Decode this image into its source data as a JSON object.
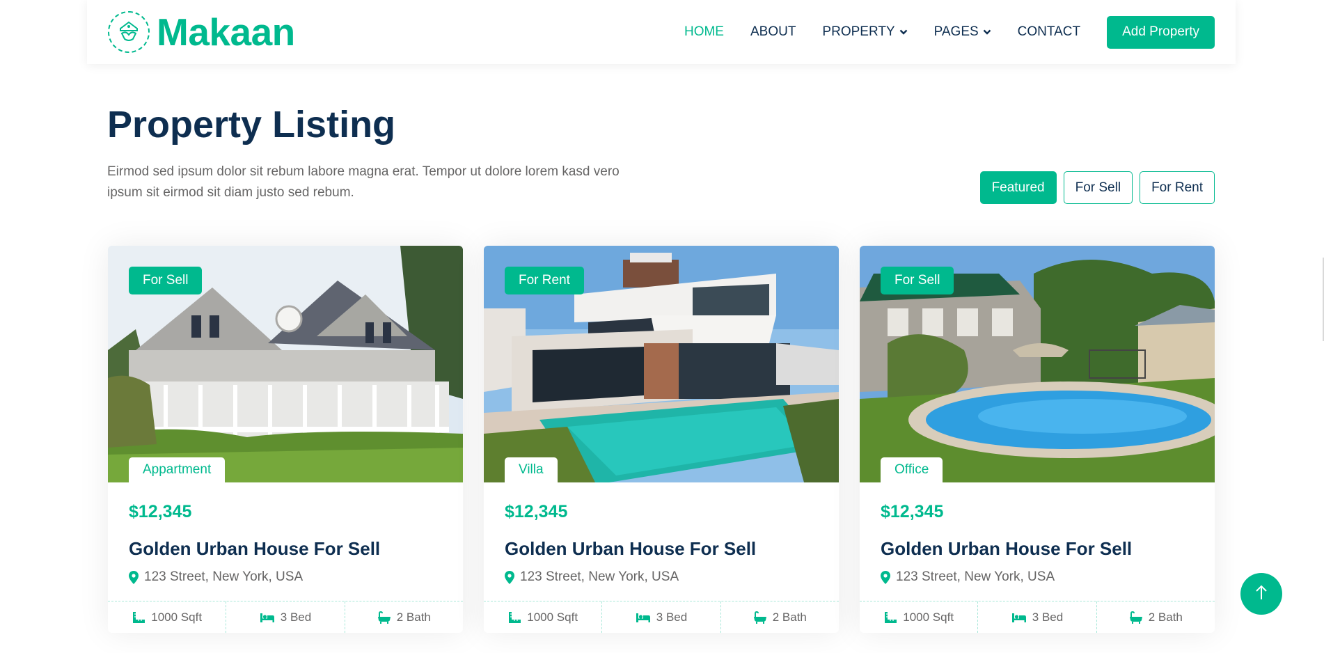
{
  "brand": {
    "name": "Makaan",
    "logo_icon": "handshake-house-icon"
  },
  "nav": {
    "items": [
      {
        "label": "HOME",
        "active": true
      },
      {
        "label": "ABOUT",
        "active": false
      },
      {
        "label": "PROPERTY",
        "active": false,
        "dropdown": true
      },
      {
        "label": "PAGES",
        "active": false,
        "dropdown": true
      },
      {
        "label": "CONTACT",
        "active": false
      }
    ],
    "cta_label": "Add Property"
  },
  "header": {
    "title": "Property Listing",
    "description": "Eirmod sed ipsum dolor sit rebum labore magna erat. Tempor ut dolore lorem kasd vero ipsum sit eirmod sit diam justo sed rebum."
  },
  "filters": [
    {
      "label": "Featured",
      "active": true
    },
    {
      "label": "For Sell",
      "active": false
    },
    {
      "label": "For Rent",
      "active": false
    }
  ],
  "cards": [
    {
      "status": "For Sell",
      "type": "Appartment",
      "price": "$12,345",
      "title": "Golden Urban House For Sell",
      "address": "123 Street, New York, USA",
      "area": "1000 Sqft",
      "beds": "3 Bed",
      "baths": "2 Bath"
    },
    {
      "status": "For Rent",
      "type": "Villa",
      "price": "$12,345",
      "title": "Golden Urban House For Sell",
      "address": "123 Street, New York, USA",
      "area": "1000 Sqft",
      "beds": "3 Bed",
      "baths": "2 Bath"
    },
    {
      "status": "For Sell",
      "type": "Office",
      "price": "$12,345",
      "title": "Golden Urban House For Sell",
      "address": "123 Street, New York, USA",
      "area": "1000 Sqft",
      "beds": "3 Bed",
      "baths": "2 Bath"
    }
  ],
  "colors": {
    "primary": "#00b98e",
    "dark": "#0e2e50",
    "text": "#666565"
  }
}
